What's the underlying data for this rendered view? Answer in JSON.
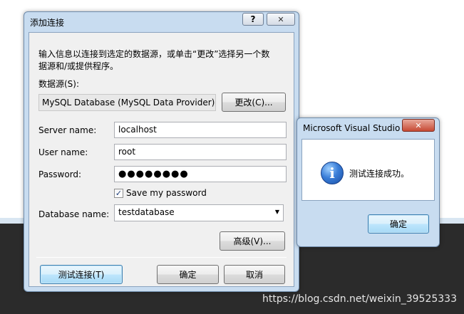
{
  "main_dialog": {
    "title": "添加连接",
    "help_glyph": "?",
    "close_glyph": "✕",
    "description_line1": "输入信息以连接到选定的数据源，或单击“更改”选择另一个数",
    "description_line2": "据源和/或提供程序。",
    "datasource_label": "数据源(S):",
    "datasource_value": "MySQL Database (MySQL Data Provider)",
    "change_button": "更改(C)...",
    "server_label": "Server name:",
    "server_value": "localhost",
    "user_label": "User name:",
    "user_value": "root",
    "password_label": "Password:",
    "password_mask": "●●●●●●●●",
    "save_password_label": "Save my password",
    "save_password_checked": "✓",
    "database_label": "Database name:",
    "database_value": "testdatabase",
    "dropdown_glyph": "▼",
    "advanced_button": "高级(V)...",
    "test_button": "测试连接(T)",
    "ok_button": "确定",
    "cancel_button": "取消"
  },
  "message_box": {
    "title": "Microsoft Visual Studio",
    "close_glyph": "✕",
    "info_glyph": "i",
    "message": "测试连接成功。",
    "ok_button": "确定"
  },
  "watermark": "https://blog.csdn.net/weixin_39525333"
}
